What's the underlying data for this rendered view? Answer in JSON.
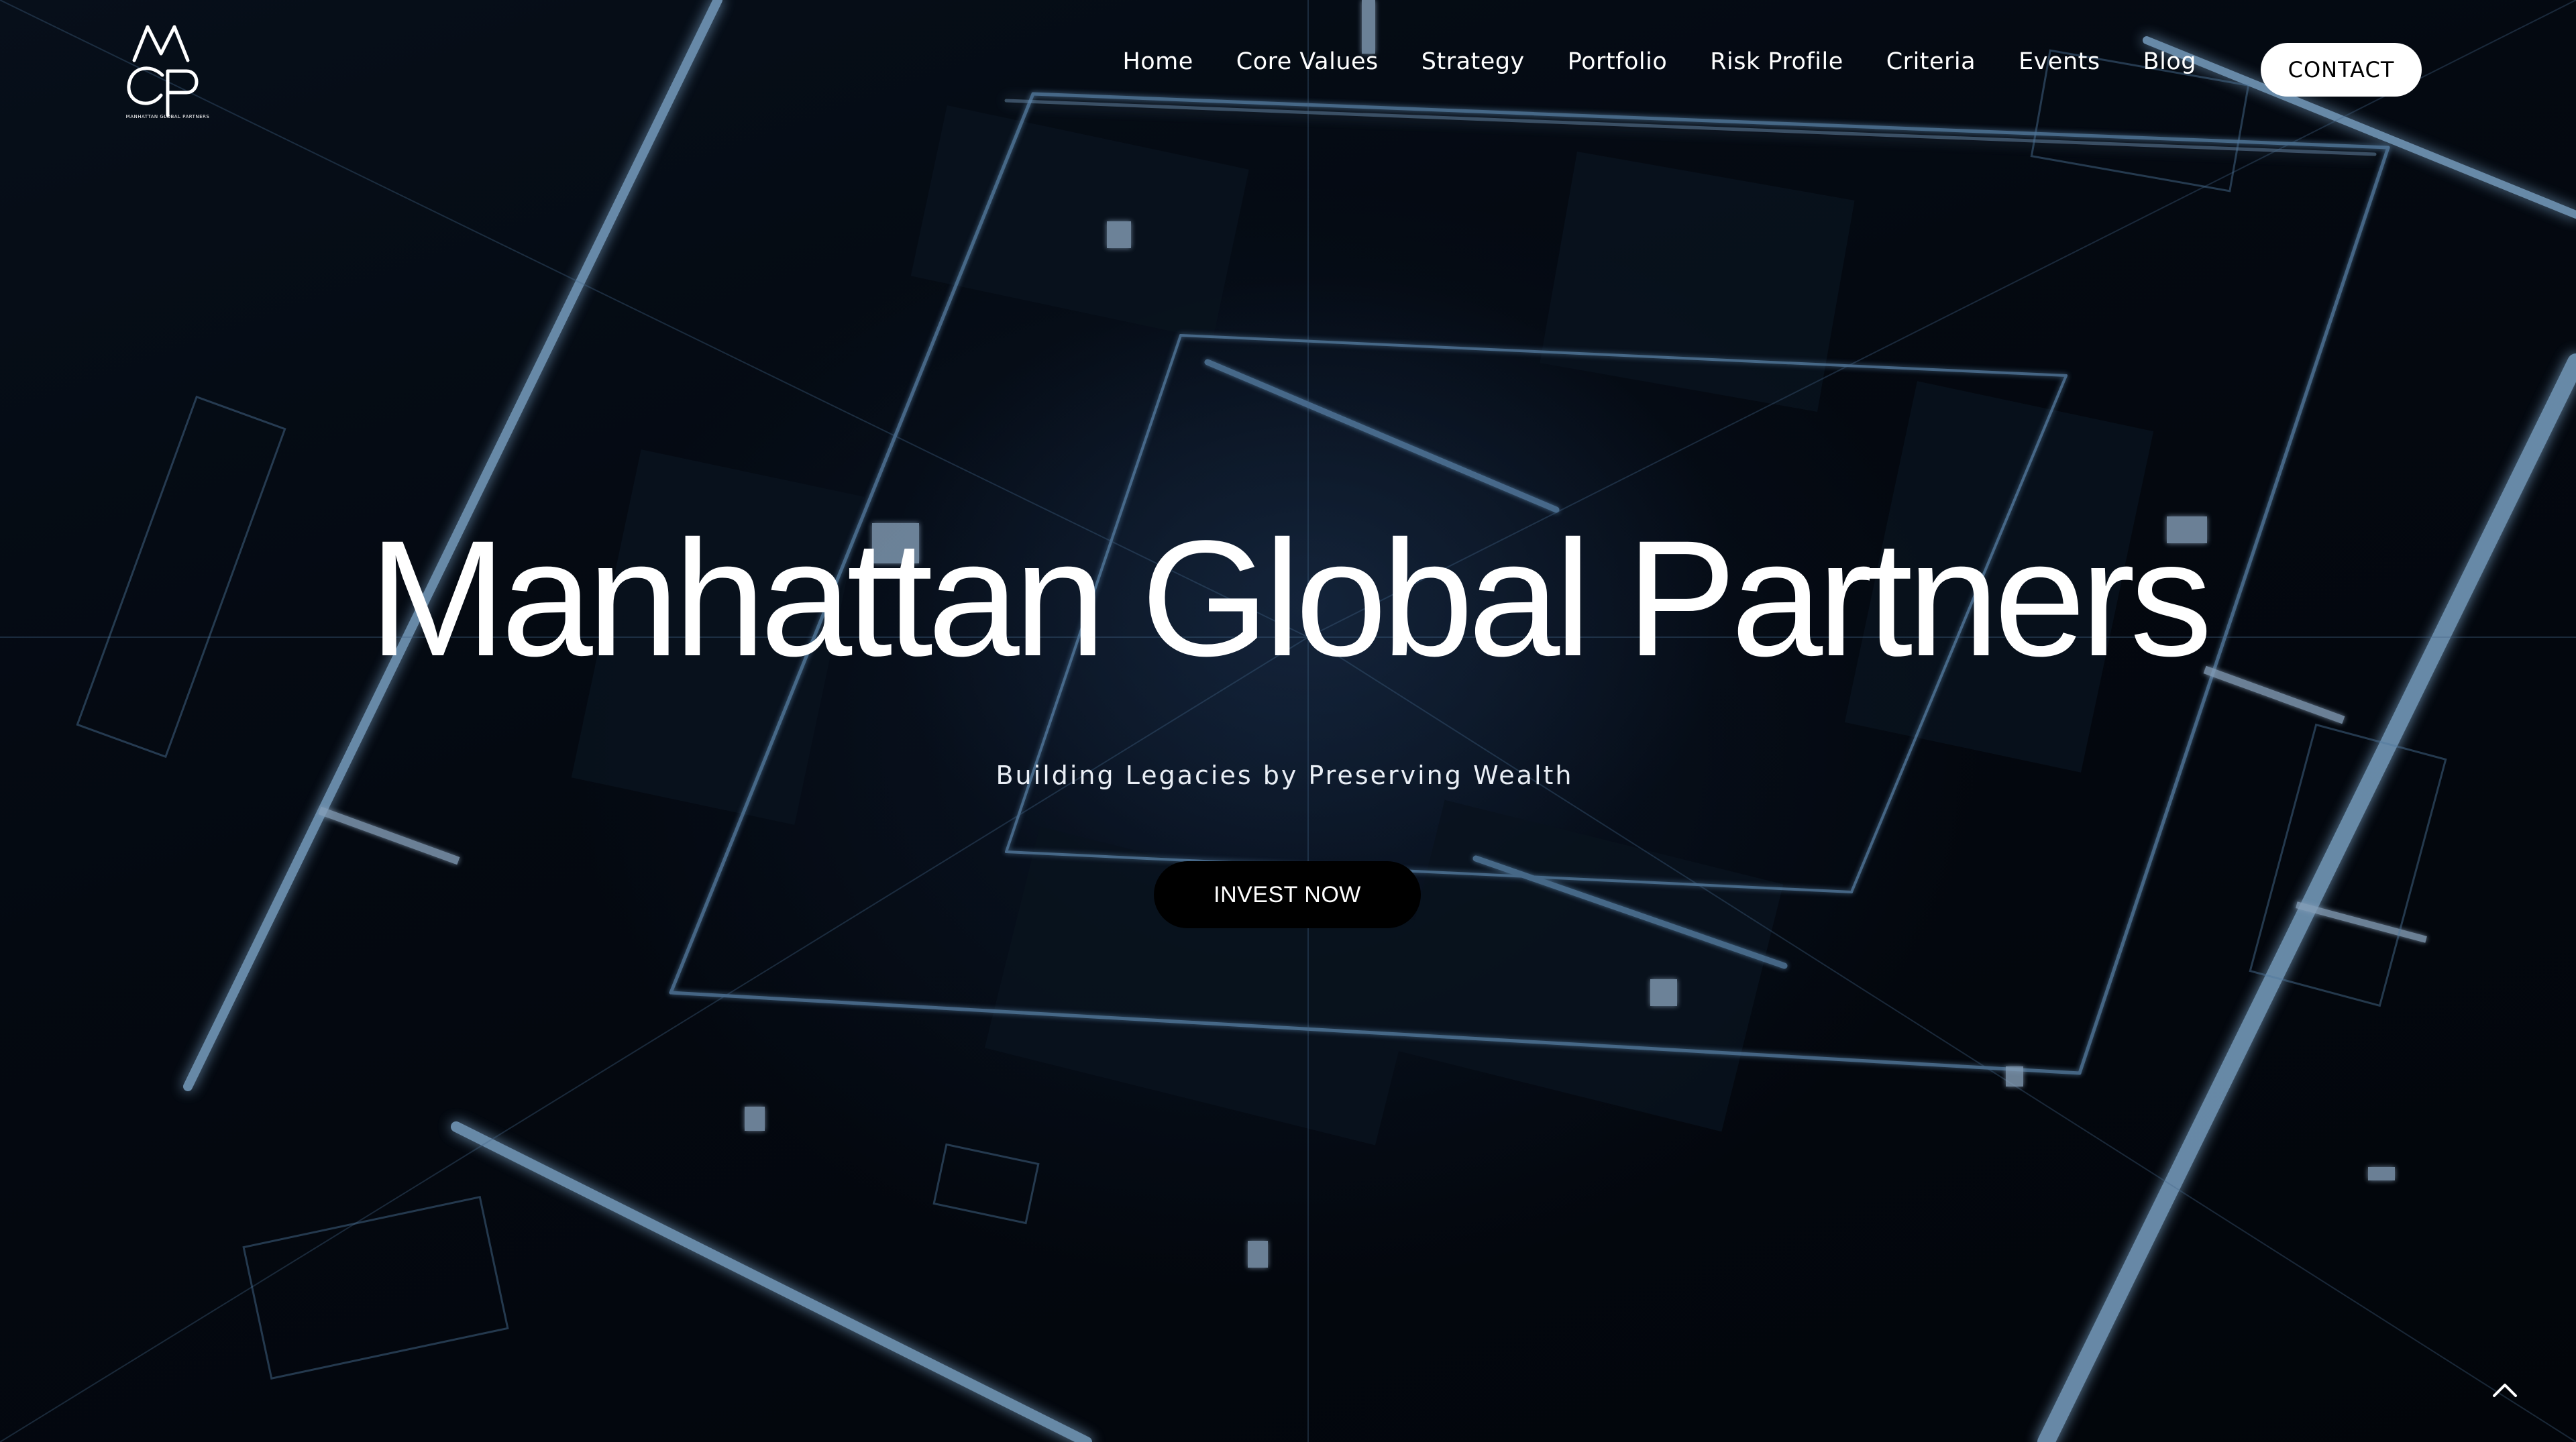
{
  "brand": {
    "logo_name": "MGP logo",
    "logo_tagline": "MANHATTAN GLOBAL PARTNERS"
  },
  "nav": {
    "items": [
      {
        "label": "Home"
      },
      {
        "label": "Core Values"
      },
      {
        "label": "Strategy"
      },
      {
        "label": "Portfolio"
      },
      {
        "label": "Risk Profile"
      },
      {
        "label": "Criteria"
      },
      {
        "label": "Events"
      },
      {
        "label": "Blog"
      }
    ],
    "contact_label": "CONTACT"
  },
  "hero": {
    "title": "Manhattan Global Partners",
    "subtitle": "Building Legacies by Preserving Wealth",
    "cta_label": "INVEST NOW"
  },
  "icons": {
    "scroll_top": "chevron-up-icon"
  },
  "colors": {
    "background": "#050a12",
    "accent_glow": "#8fc6ff",
    "text": "#ffffff",
    "contact_bg": "#ffffff",
    "cta_bg": "#000000"
  }
}
